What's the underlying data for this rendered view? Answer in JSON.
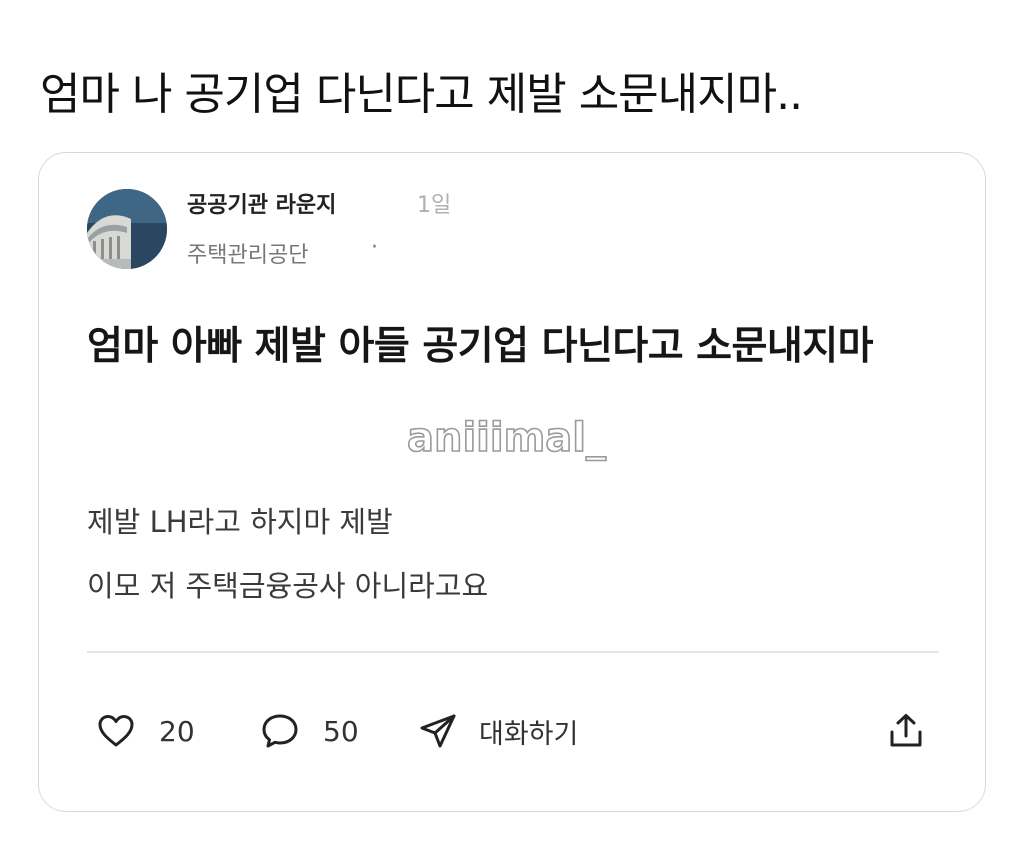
{
  "headline": "엄마 나 공기업 다닌다고 제발 소문내지마..",
  "post": {
    "author": "공공기관 라운지",
    "time": "1일",
    "board": "주택관리공단",
    "board_separator": "·",
    "title": "엄마 아빠 제발 아들 공기업 다닌다고 소문내지마",
    "body_lines": [
      "제발 LH라고 하지마 제발",
      "이모 저 주택금융공사 아니라고요"
    ]
  },
  "watermark": "aniiimal_",
  "actions": {
    "like_icon": "heart-icon",
    "like_count": "20",
    "comment_icon": "speech-bubble-icon",
    "comment_count": "50",
    "message_icon": "paper-plane-icon",
    "message_label": "대화하기",
    "share_icon": "upload-icon"
  },
  "colors": {
    "text": "#111111",
    "muted": "#777777",
    "time": "#b0b0b0",
    "border": "#d9d9d9",
    "avatar_bg": "#2d4a63"
  }
}
